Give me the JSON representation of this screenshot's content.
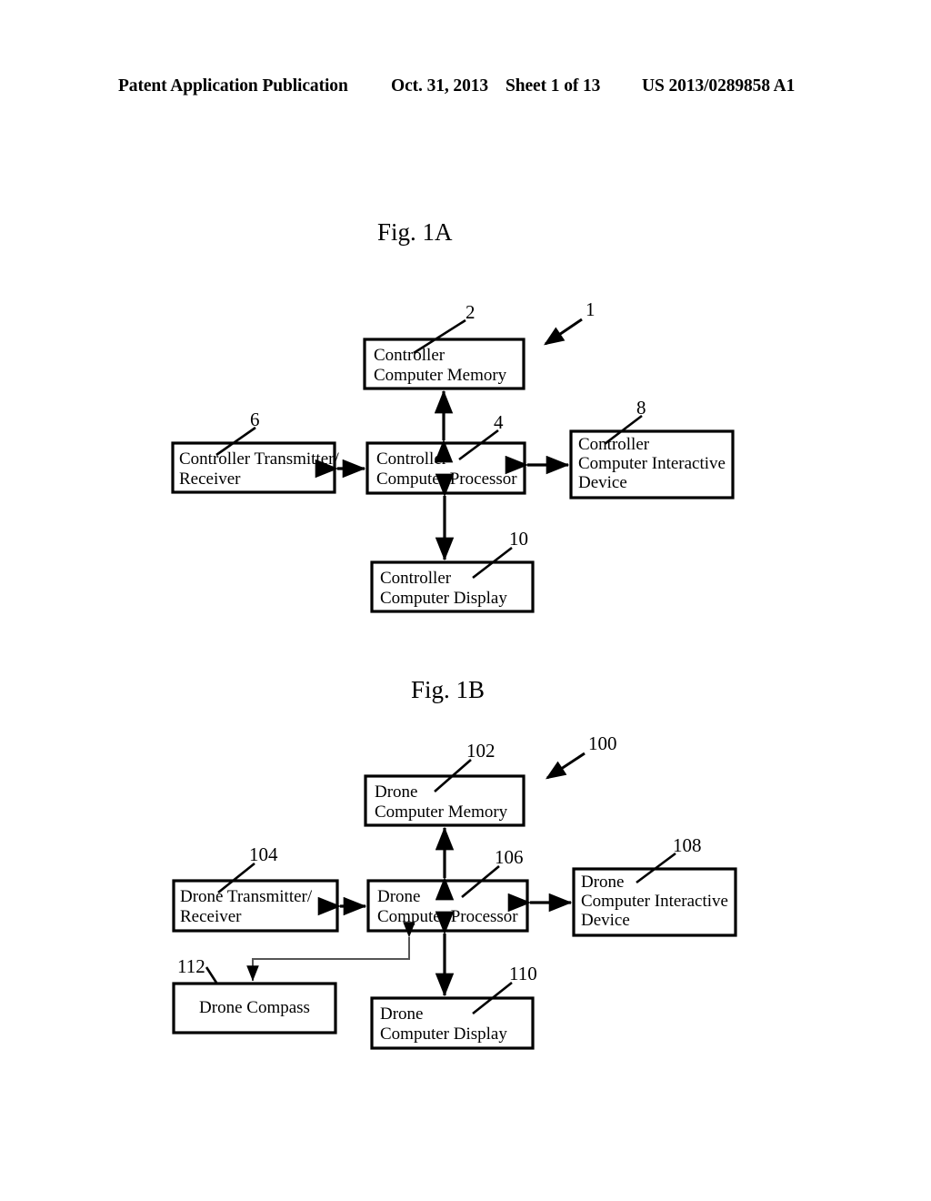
{
  "header": {
    "publication": "Patent Application Publication",
    "date": "Oct. 31, 2013",
    "sheet": "Sheet 1 of 13",
    "patent_number": "US 2013/0289858 A1"
  },
  "figures": [
    {
      "id": "fig-1a",
      "title": "Fig. 1A",
      "system_ref": "1",
      "boxes": [
        {
          "id": "controller-memory",
          "lines": [
            "Controller",
            "Computer Memory"
          ],
          "ref": "2",
          "align": "left"
        },
        {
          "id": "controller-transmitter",
          "lines": [
            "Controller Transmitter/",
            "Receiver"
          ],
          "ref": "6",
          "align": "left"
        },
        {
          "id": "controller-processor",
          "lines": [
            "Controller",
            "Computer Processor"
          ],
          "ref": "4",
          "align": "left"
        },
        {
          "id": "controller-interactive",
          "lines": [
            "Controller",
            "Computer Interactive",
            "Device"
          ],
          "ref": "8",
          "align": "left"
        },
        {
          "id": "controller-display",
          "lines": [
            "Controller",
            "Computer Display"
          ],
          "ref": "10",
          "align": "left"
        }
      ],
      "connections": [
        {
          "from": "controller-processor",
          "to": "controller-memory",
          "style": "double-arrow"
        },
        {
          "from": "controller-transmitter",
          "to": "controller-processor",
          "style": "double-arrow"
        },
        {
          "from": "controller-processor",
          "to": "controller-interactive",
          "style": "double-arrow"
        },
        {
          "from": "controller-processor",
          "to": "controller-display",
          "style": "double-arrow"
        }
      ]
    },
    {
      "id": "fig-1b",
      "title": "Fig. 1B",
      "system_ref": "100",
      "boxes": [
        {
          "id": "drone-memory",
          "lines": [
            "Drone",
            "Computer Memory"
          ],
          "ref": "102",
          "align": "left"
        },
        {
          "id": "drone-transmitter",
          "lines": [
            "Drone Transmitter/",
            "Receiver"
          ],
          "ref": "104",
          "align": "left"
        },
        {
          "id": "drone-processor",
          "lines": [
            "Drone",
            "Computer Processor"
          ],
          "ref": "106",
          "align": "left"
        },
        {
          "id": "drone-interactive",
          "lines": [
            "Drone",
            "Computer Interactive",
            "Device"
          ],
          "ref": "108",
          "align": "left"
        },
        {
          "id": "drone-display",
          "lines": [
            "Drone",
            "Computer Display"
          ],
          "ref": "110",
          "align": "left"
        },
        {
          "id": "drone-compass",
          "lines": [
            "Drone Compass"
          ],
          "ref": "112",
          "align": "center"
        }
      ],
      "connections": [
        {
          "from": "drone-processor",
          "to": "drone-memory",
          "style": "double-arrow"
        },
        {
          "from": "drone-transmitter",
          "to": "drone-processor",
          "style": "double-arrow"
        },
        {
          "from": "drone-processor",
          "to": "drone-interactive",
          "style": "double-arrow"
        },
        {
          "from": "drone-processor",
          "to": "drone-display",
          "style": "double-arrow"
        },
        {
          "from": "drone-compass",
          "to": "drone-processor",
          "style": "elbow-double-arrow"
        }
      ]
    }
  ],
  "colors": {
    "ink": "#000000",
    "paper": "#ffffff",
    "thin_connector": "#555555"
  }
}
